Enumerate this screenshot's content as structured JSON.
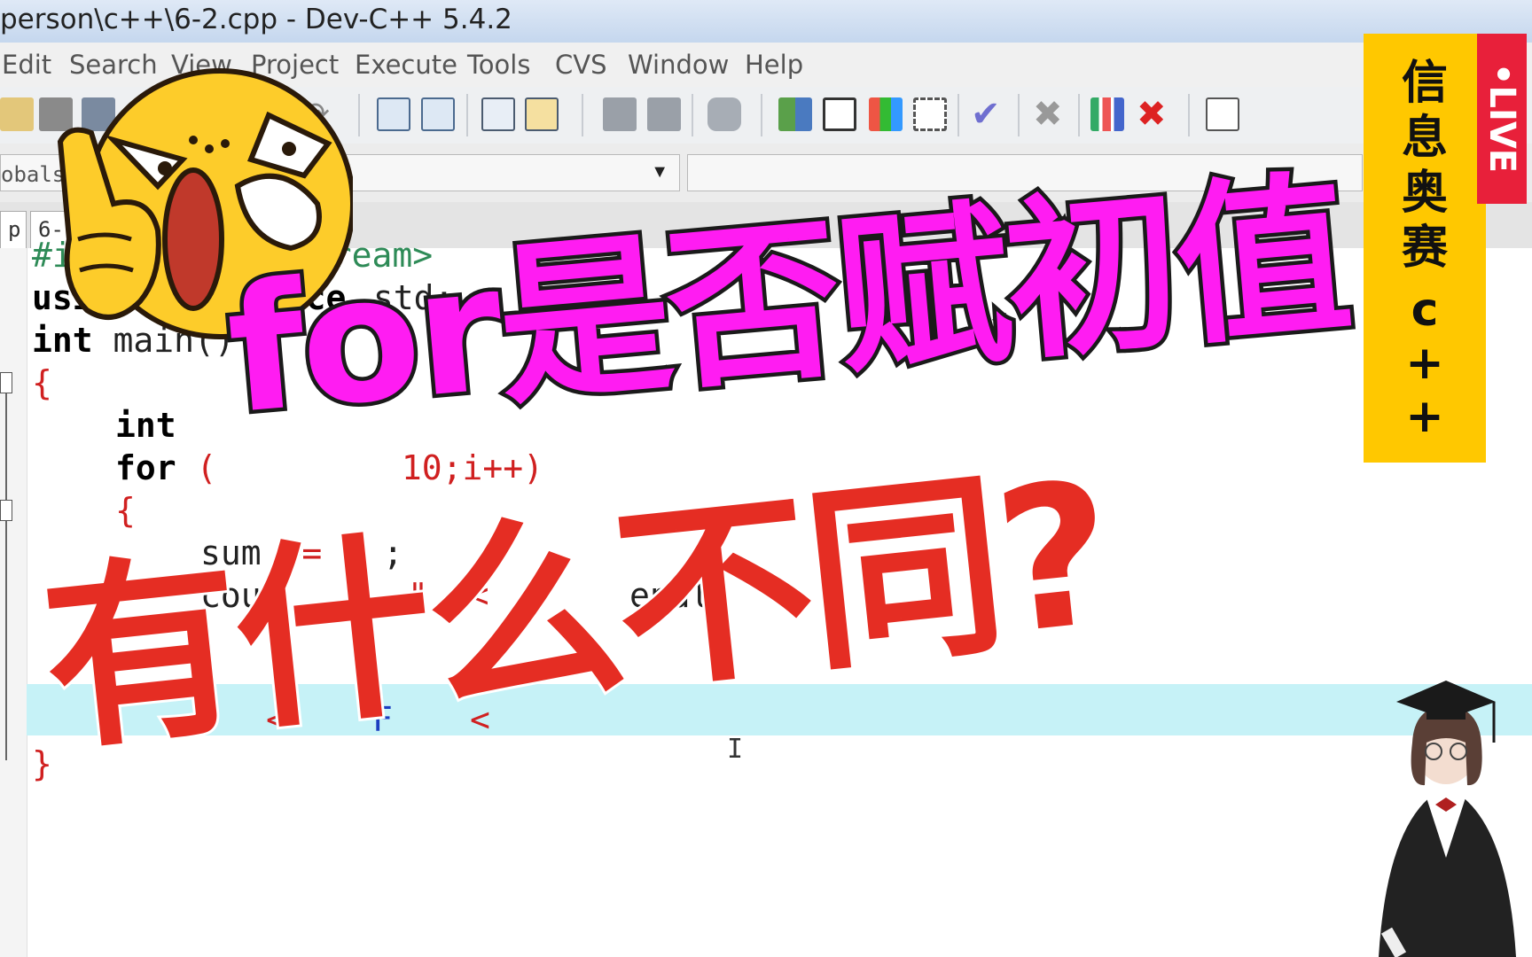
{
  "window": {
    "title": "person\\c++\\6-2.cpp - Dev-C++ 5.4.2"
  },
  "menu": [
    "Edit",
    "Search",
    "View",
    "Project",
    "Execute",
    "Tools",
    "CVS",
    "Window",
    "Help"
  ],
  "toolbar": {
    "icons": [
      "edit-icon",
      "save-icon",
      "save-all-icon",
      "undo-icon",
      "redo-icon",
      "find-icon",
      "find-next-icon",
      "indent-icon",
      "unindent-icon",
      "back-icon",
      "forward-icon",
      "bookmark-icon",
      "new-class-icon",
      "window-icon",
      "color-grid-icon",
      "grid-icon",
      "check-icon",
      "close-icon",
      "chart-icon",
      "stop-icon",
      "debug-icon"
    ]
  },
  "class_browser": {
    "scope_label": "obals"
  },
  "tabs": [
    "p",
    "6-"
  ],
  "code": {
    "line1_kw": "#i",
    "line1_rest": "stream>",
    "line2_a": "usi",
    "line2_b": "space",
    "line2_c": " std;",
    "line3_kw": "int",
    "line3_rest": " main()",
    "line4": "{",
    "line5_kw": "int",
    "line6_kw": "for",
    "line6_rest": " (",
    "line6_tail": " 10;i++)",
    "line7": "{",
    "line8_a": "sum ",
    "line8_op": "+=",
    "line8_b": " i ;",
    "line9_a": "cou",
    "line9_b": "\" <<",
    "line9_c": "endl",
    "line11_a": "<",
    "line11_b": "F",
    "line11_c": "<",
    "line12": "}",
    "caret": "I"
  },
  "overlay": {
    "headline_top": "for是否赋初值",
    "headline_bottom": "有什么不同?",
    "side_banner": [
      "信",
      "息",
      "奥",
      "赛",
      "c",
      "+",
      "+"
    ],
    "live_badge": "•LIVE"
  },
  "colors": {
    "magenta": "#ff1cf2",
    "red": "#e52d23",
    "banner_yellow": "#ffc800",
    "live_red": "#e8203a"
  }
}
